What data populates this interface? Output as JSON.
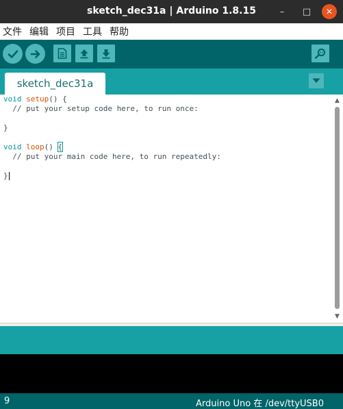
{
  "window": {
    "title": "sketch_dec31a | Arduino 1.8.15",
    "minimize_glyph": "–",
    "maximize_glyph": "□",
    "close_glyph": "✕"
  },
  "menubar": {
    "items": [
      "文件",
      "编辑",
      "项目",
      "工具",
      "帮助"
    ]
  },
  "toolbar": {
    "buttons": [
      {
        "name": "verify",
        "icon": "checkmark-icon"
      },
      {
        "name": "upload",
        "icon": "arrow-right-icon"
      },
      {
        "name": "new",
        "icon": "new-file-icon"
      },
      {
        "name": "open",
        "icon": "arrow-up-icon"
      },
      {
        "name": "save",
        "icon": "arrow-down-icon"
      },
      {
        "name": "serial-monitor",
        "icon": "magnifier-icon"
      }
    ],
    "colors": {
      "bar": "#006468",
      "button": "#4db7bb",
      "glyph": "#006468"
    }
  },
  "tabs": [
    {
      "label": "sketch_dec31a",
      "active": true
    }
  ],
  "editor": {
    "lines": [
      {
        "kw": "void",
        "fn": "setup",
        "rest": "() {"
      },
      {
        "comment": "  // put your setup code here, to run once:"
      },
      {
        "text": ""
      },
      {
        "text": "}"
      },
      {
        "text": ""
      },
      {
        "kw": "void",
        "fn": "loop",
        "rest": "() ",
        "brace": "{"
      },
      {
        "comment": "  // put your main code here, to run repeatedly:"
      },
      {
        "text": ""
      },
      {
        "close": "}"
      }
    ],
    "colors": {
      "keyword": "#00979c",
      "function": "#d35400",
      "text": "#434f54"
    }
  },
  "status": {
    "line_number": "9",
    "board": "Arduino Uno 在 /dev/ttyUSB0"
  }
}
